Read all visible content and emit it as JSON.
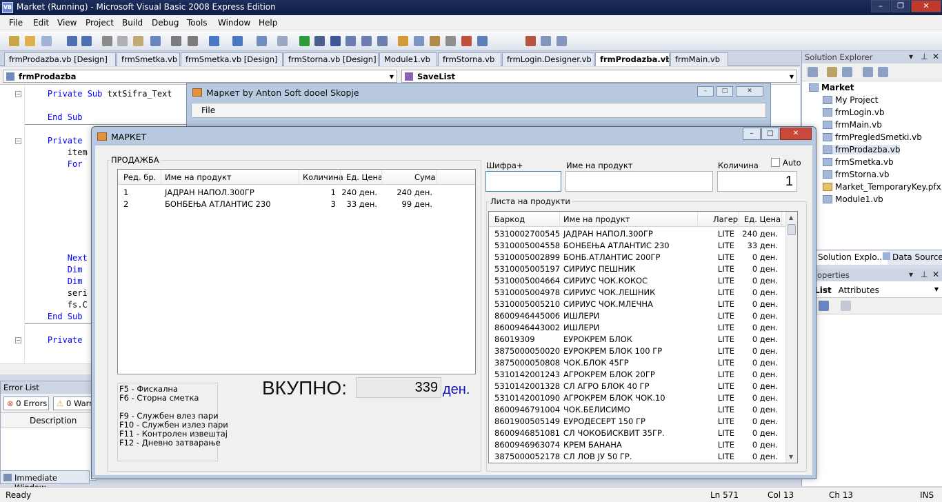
{
  "ide": {
    "title": "Market (Running) - Microsoft Visual Basic 2008 Express Edition",
    "logo": "VB",
    "window_buttons": [
      "–",
      "❐",
      "✕"
    ],
    "menu": [
      "File",
      "Edit",
      "View",
      "Project",
      "Build",
      "Debug",
      "Tools",
      "Window",
      "Help"
    ],
    "tabs": [
      "frmProdazba.vb [Design]",
      "frmSmetka.vb",
      "frmSmetka.vb [Design]",
      "frmStorna.vb [Design]",
      "Module1.vb",
      "frmStorna.vb",
      "frmLogin.Designer.vb",
      "frmProdazba.vb",
      "frmMain.vb"
    ],
    "active_tab": "frmProdazba.vb",
    "class_dropdown": "frmProdazba",
    "method_dropdown": "SaveList",
    "code_lines": [
      {
        "indent": "    ",
        "kw": "Private Sub",
        "rest": " txtSifra_Text"
      },
      {
        "indent": "    ",
        "kw": "End Sub",
        "rest": ""
      },
      {
        "indent": "    ",
        "kw": "Private",
        "rest": ""
      },
      {
        "indent": "        ",
        "kw": "",
        "rest": "item"
      },
      {
        "indent": "        ",
        "kw": "For",
        "rest": ""
      },
      {
        "indent": "        ",
        "kw": "Next",
        "rest": ""
      },
      {
        "indent": "        ",
        "kw": "Dim",
        "rest": ""
      },
      {
        "indent": "        ",
        "kw": "Dim",
        "rest": ""
      },
      {
        "indent": "        ",
        "kw": "",
        "rest": "seri"
      },
      {
        "indent": "        ",
        "kw": "",
        "rest": "fs.C"
      },
      {
        "indent": "    ",
        "kw": "End Sub",
        "rest": ""
      },
      {
        "indent": "    ",
        "kw": "Private",
        "rest": ""
      }
    ],
    "error_list": {
      "title": "Error List",
      "errors": "0 Errors",
      "warnings": "0 Warn",
      "column": "Description"
    },
    "immediate_window": "Immediate Window",
    "status": {
      "left": "Ready",
      "ln": "Ln 571",
      "col": "Col 13",
      "ch": "Ch 13",
      "mode": "INS"
    },
    "solution_explorer": {
      "title": "Solution Explorer",
      "project": "Market",
      "items": [
        "My Project",
        "frmLogin.vb",
        "frmMain.vb",
        "frmPregledSmetki.vb",
        "frmProdazba.vb",
        "frmSmetka.vb",
        "frmStorna.vb",
        "Market_TemporaryKey.pfx",
        "Module1.vb"
      ],
      "selected": "frmProdazba.vb",
      "bottom_tabs": [
        "Solution Explo...",
        "Data Sources"
      ]
    },
    "properties": {
      "title": "operties",
      "object": "eList",
      "object_type": "Attributes"
    }
  },
  "bg_form": {
    "title": "Маркет by Anton Soft dooel Skopje",
    "menu": "File"
  },
  "dialog": {
    "title": "МАРКЕТ",
    "sale": {
      "group_label": "ПРОДАЖБА",
      "columns": [
        "Ред. бр.",
        "Име на продукт",
        "Количина",
        "Ед. Цена",
        "Сума"
      ],
      "rows": [
        {
          "no": "1",
          "name": "ЈАДРАН НАПОЛ.300ГР",
          "qty": "1",
          "price": "240 ден.",
          "sum": "240 ден."
        },
        {
          "no": "2",
          "name": "БОНБЕЊА АТЛАНТИС 230",
          "qty": "3",
          "price": "33 ден.",
          "sum": "99 ден."
        }
      ]
    },
    "keys": [
      "F5 - Фискална",
      "F6 - Сторна сметка",
      "",
      "F9 - Службен влез пари",
      "F10 - Службен излез пари",
      "F11 - Контролен извештај",
      "F12 - Дневно затварање"
    ],
    "total": {
      "label": "ВКУПНО:",
      "value": "339",
      "currency": "ден."
    },
    "inputs": {
      "code_label": "Шифра+",
      "code_value": "",
      "name_label": "Име на продукт",
      "name_value": "",
      "qty_label": "Количина",
      "qty_value": "1",
      "auto_label": "Auto",
      "auto_checked": false
    },
    "products": {
      "group_label": "Листа на продукти",
      "columns": [
        "Баркод",
        "Име на продукт",
        "Лагер",
        "Ед. Цена"
      ],
      "rows": [
        {
          "code": "5310002700545",
          "name": "ЈАДРАН НАПОЛ.300ГР",
          "stock": "LITE",
          "price": "240 ден."
        },
        {
          "code": "5310005004558",
          "name": "БОНБЕЊА АТЛАНТИС 230",
          "stock": "LITE",
          "price": "33 ден."
        },
        {
          "code": "5310005002899",
          "name": "БОНБ.АТЛАНТИС 200ГР",
          "stock": "LITE",
          "price": "0 ден."
        },
        {
          "code": "5310005005197",
          "name": "СИРИУС ПЕШНИК",
          "stock": "LITE",
          "price": "0 ден."
        },
        {
          "code": "5310005004664",
          "name": "СИРИУС ЧОК.КОКОС",
          "stock": "LITE",
          "price": "0 ден."
        },
        {
          "code": "5310005004978",
          "name": "СИРИУС ЧОК.ЛЕШНИК",
          "stock": "LITE",
          "price": "0 ден."
        },
        {
          "code": "5310005005210",
          "name": "СИРИУС ЧОК.МЛЕЧНА",
          "stock": "LITE",
          "price": "0 ден."
        },
        {
          "code": "8600946445006",
          "name": "ИШЛЕРИ",
          "stock": "LITE",
          "price": "0 ден."
        },
        {
          "code": "8600946443002",
          "name": "ИШЛЕРИ",
          "stock": "LITE",
          "price": "0 ден."
        },
        {
          "code": "86019309",
          "name": "ЕУРОКРЕМ БЛОК",
          "stock": "LITE",
          "price": "0 ден."
        },
        {
          "code": "3875000050020",
          "name": "ЕУРОКРЕМ БЛОК 100 ГР",
          "stock": "LITE",
          "price": "0 ден."
        },
        {
          "code": "3875000050808",
          "name": "ЧОК.БЛОК 45ГР",
          "stock": "LITE",
          "price": "0 ден."
        },
        {
          "code": "5310142001243",
          "name": "АГРОКРЕМ БЛОК 20ГР",
          "stock": "LITE",
          "price": "0 ден."
        },
        {
          "code": "5310142001328",
          "name": "СЛ АГРО БЛОК 40 ГР",
          "stock": "LITE",
          "price": "0 ден."
        },
        {
          "code": "5310142001090",
          "name": "АГРОКРЕМ БЛОК ЧОК.10",
          "stock": "LITE",
          "price": "0 ден."
        },
        {
          "code": "8600946791004",
          "name": "ЧОК.БЕЛИСИМО",
          "stock": "LITE",
          "price": "0 ден."
        },
        {
          "code": "8601900505149",
          "name": "ЕУРОДЕСЕРТ 150 ГР",
          "stock": "LITE",
          "price": "0 ден."
        },
        {
          "code": "8600946851081",
          "name": "СЛ ЧОКОБИСКВИТ 35ГР.",
          "stock": "LITE",
          "price": "0 ден."
        },
        {
          "code": "8600946963074",
          "name": "КРЕМ БАНАНА",
          "stock": "LITE",
          "price": "0 ден."
        },
        {
          "code": "3875000052178",
          "name": "СЛ ЛОВ ЈУ 50 ГР.",
          "stock": "LITE",
          "price": "0 ден."
        }
      ]
    }
  }
}
